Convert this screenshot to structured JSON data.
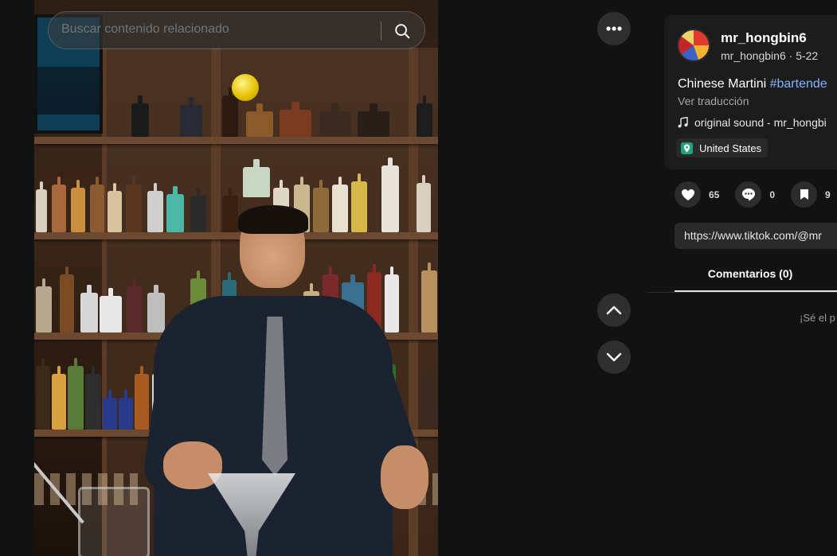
{
  "search": {
    "placeholder": "Buscar contenido relacionado",
    "icon": "search-icon"
  },
  "video_controls": {
    "more_icon": "more-horizontal-icon",
    "prev_icon": "chevron-up-icon",
    "next_icon": "chevron-down-icon"
  },
  "post": {
    "username": "mr_hongbin6",
    "handle": "mr_hongbin6",
    "separator": " · ",
    "date": "5-22",
    "caption_text": "Chinese Martini ",
    "hashtag": "#bartende",
    "translate_label": "Ver traducción",
    "sound_label": "original sound - mr_hongbi",
    "location": "United States"
  },
  "stats": {
    "likes": "65",
    "comments": "0",
    "saves": "9"
  },
  "share": {
    "link": "https://www.tiktok.com/@mr"
  },
  "tabs": {
    "comments_label": "Comentarios (0)"
  },
  "comments": {
    "empty_text": "¡Sé el p"
  },
  "colors": {
    "background": "#121212",
    "card": "#1c1c1c",
    "hashtag": "#7fb4ff",
    "location_icon": "#1ea37f"
  }
}
